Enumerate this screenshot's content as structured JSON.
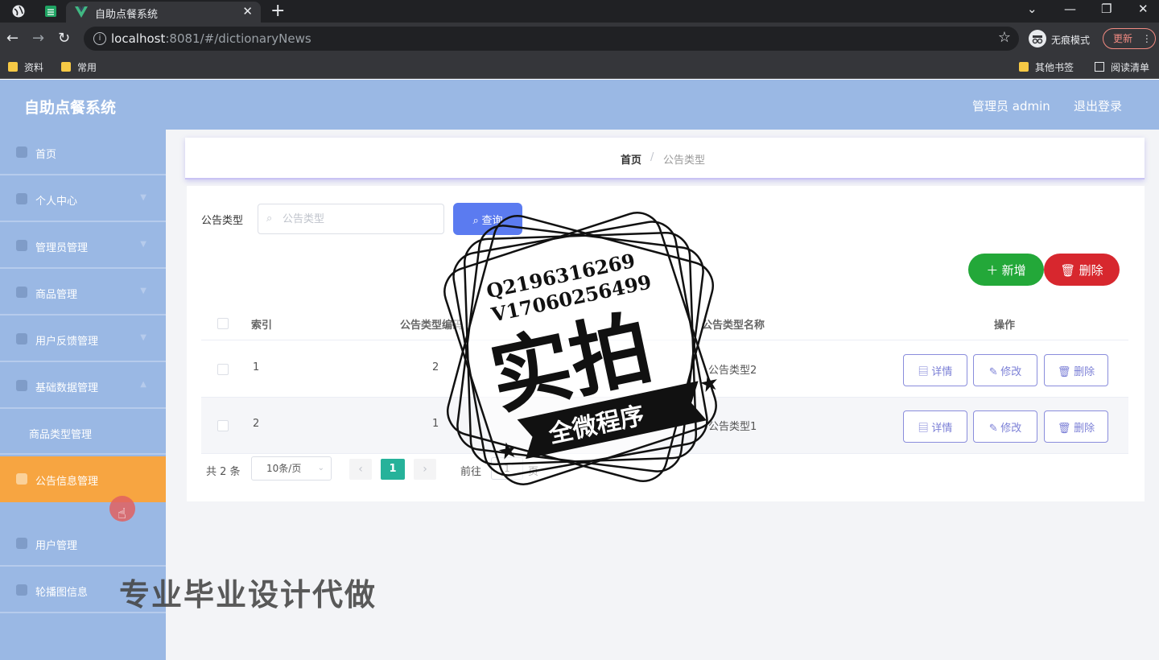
{
  "browser": {
    "tab_title": "自助点餐系统",
    "url_host": "localhost",
    "url_rest": ":8081/#/dictionaryNews",
    "incognito_label": "无痕模式",
    "update_label": "更新",
    "bookmarks": [
      "资料",
      "常用"
    ],
    "other_bookmarks": "其他书签",
    "reading_list": "阅读清单"
  },
  "header": {
    "title": "自助点餐系统",
    "admin_label": "管理员 admin",
    "logout_label": "退出登录"
  },
  "sidebar": {
    "items": [
      {
        "label": "首页",
        "icon": "home-icon"
      },
      {
        "label": "个人中心",
        "icon": "user-icon"
      },
      {
        "label": "管理员管理",
        "icon": "admin-icon"
      },
      {
        "label": "商品管理",
        "icon": "goods-icon"
      },
      {
        "label": "用户反馈管理",
        "icon": "feedback-icon"
      },
      {
        "label": "基础数据管理",
        "icon": "data-icon"
      },
      {
        "label": "商品类型管理",
        "icon": ""
      },
      {
        "label": "公告信息管理",
        "icon": "notice-icon"
      },
      {
        "label": "用户管理",
        "icon": "users-icon"
      },
      {
        "label": "轮播图信息",
        "icon": "carousel-icon"
      }
    ]
  },
  "breadcrumb": {
    "home": "首页",
    "separator": "/",
    "current": "公告类型"
  },
  "search": {
    "label": "公告类型",
    "placeholder": "公告类型",
    "value": "",
    "query_label": "查询"
  },
  "actions": {
    "add_label": "新增",
    "delete_label": "删除"
  },
  "table": {
    "columns": [
      "索引",
      "公告类型编码",
      "公告类型名称",
      "操作"
    ],
    "rows": [
      {
        "index": "1",
        "code": "2",
        "name": "公告类型2"
      },
      {
        "index": "2",
        "code": "1",
        "name": "公告类型1"
      }
    ],
    "op_detail": "详情",
    "op_edit": "修改",
    "op_delete": "删除"
  },
  "pagination": {
    "total": "共 2 条",
    "page_size": "10条/页",
    "current": "1",
    "goto_label": "前往",
    "goto_value": "1",
    "page_suffix": "页"
  },
  "watermark": {
    "line1": "Q2196316269",
    "line2": "V17060256499",
    "big": "实拍",
    "ribbon": "全微程序",
    "bottom": "专业毕业设计代做"
  },
  "colors": {
    "header_bg": "#9ab8e4",
    "active_menu": "#f7a541",
    "query_btn": "#5b7bf0",
    "add_btn": "#23a839",
    "delete_btn": "#d7272e",
    "pager_active": "#26b29a"
  }
}
